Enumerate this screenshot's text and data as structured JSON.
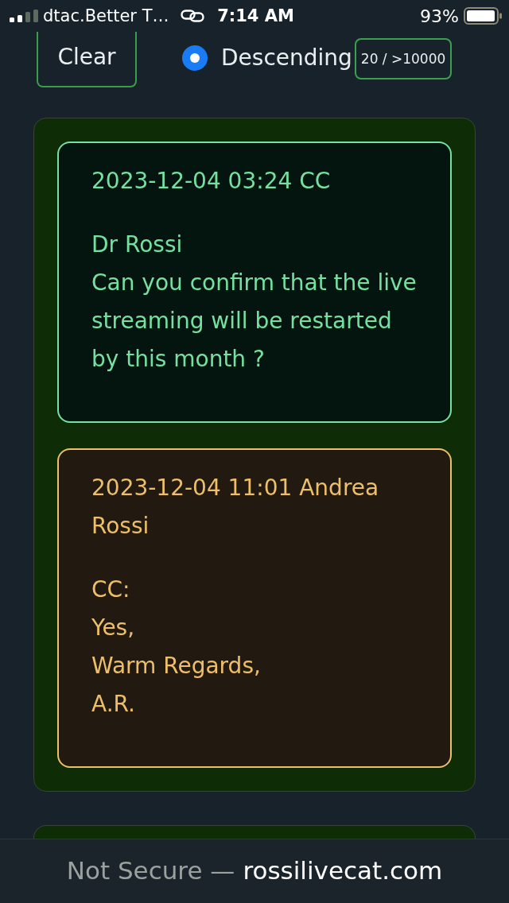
{
  "status_bar": {
    "carrier": "dtac.Better T…",
    "time": "7:14 AM",
    "battery": "93%"
  },
  "toolbar": {
    "clear_button": "Clear",
    "sort_option": {
      "label": "Descending",
      "selected": true
    },
    "count": "20 / >10000"
  },
  "thread": {
    "messages": [
      {
        "kind": "comment",
        "color": "#76e0a2",
        "header": "2023-12-04 03:24 CC",
        "body": "Dr Rossi\nCan you confirm that the live streaming will be restarted by this month ?"
      },
      {
        "kind": "reply",
        "color": "#eebf6a",
        "header": "2023-12-04 11:01 Andrea Rossi",
        "body": "CC:\nYes,\nWarm Regards,\nA.R."
      }
    ]
  },
  "browser_bar": {
    "security": "Not Secure —",
    "domain": "rossilivecat.com"
  }
}
